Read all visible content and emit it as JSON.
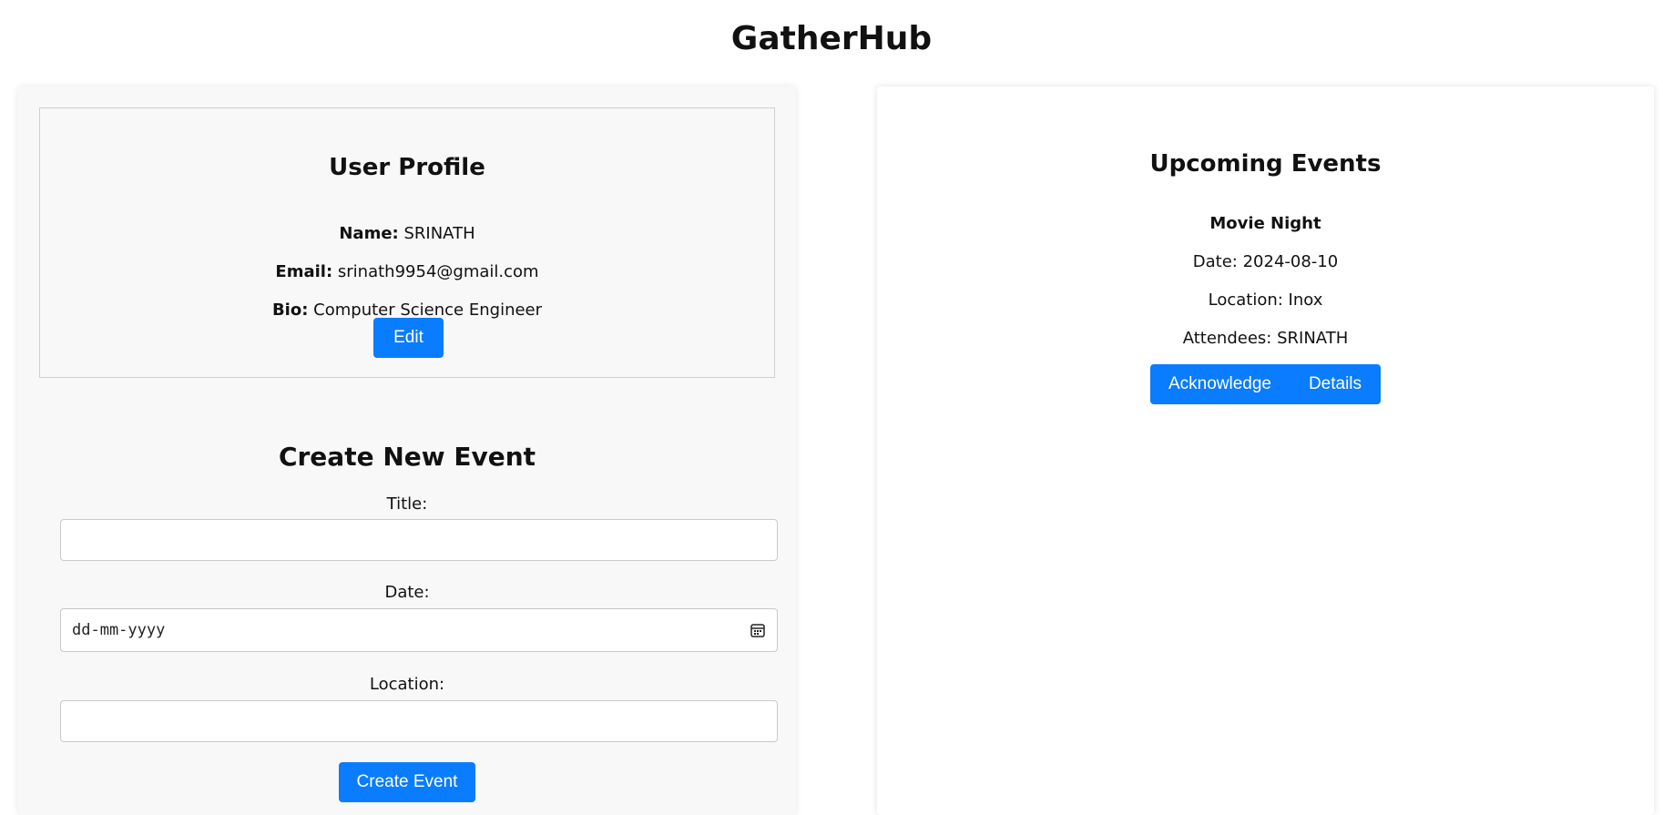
{
  "app": {
    "title": "GatherHub"
  },
  "profile": {
    "heading": "User Profile",
    "name_label": "Name:",
    "name_value": "SRINATH",
    "email_label": "Email:",
    "email_value": "srinath9954@gmail.com",
    "bio_label": "Bio:",
    "bio_value": "Computer Science Engineer",
    "edit_label": "Edit"
  },
  "create_event": {
    "heading": "Create New Event",
    "title_label": "Title:",
    "title_value": "",
    "date_label": "Date:",
    "date_placeholder": "dd-mm-yyyy",
    "location_label": "Location:",
    "location_value": "",
    "submit_label": "Create Event"
  },
  "events": {
    "heading": "Upcoming Events",
    "items": [
      {
        "title": "Movie Night",
        "date": "Date: 2024-08-10",
        "location": "Location: Inox",
        "attendees": "Attendees: SRINATH",
        "acknowledge_label": "Acknowledge",
        "details_label": "Details"
      }
    ]
  },
  "colors": {
    "accent": "#0a7cff",
    "panel_bg": "#f8f8f8"
  },
  "icons": {
    "date_picker": "calendar-icon"
  }
}
